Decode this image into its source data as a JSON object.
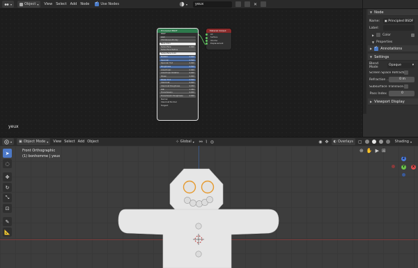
{
  "node_editor": {
    "header": {
      "mode": "Object",
      "menus": [
        "View",
        "Select",
        "Add",
        "Node"
      ],
      "use_nodes_label": "Use Nodes",
      "material_name": "yeux"
    },
    "object_name": "yeux",
    "bsdf_node": {
      "title": "Principled BSDF",
      "rows": [
        {
          "label": "BSDF",
          "value": "",
          "style": "plain"
        },
        {
          "label": "GGX",
          "value": "",
          "style": "grey"
        },
        {
          "label": "Christensen-Burley",
          "value": "",
          "style": "grey"
        },
        {
          "label": "Base Color",
          "value": "",
          "style": "white"
        },
        {
          "label": "Subsurface",
          "value": "0.000",
          "style": "grey"
        },
        {
          "label": "Subsurface Radius",
          "value": "",
          "style": "grey"
        },
        {
          "label": "Subsurface Color",
          "value": "",
          "style": "white"
        },
        {
          "label": "Metallic",
          "value": "0.000",
          "style": "blue"
        },
        {
          "label": "Specular",
          "value": "0.500",
          "style": "blue"
        },
        {
          "label": "Specular Tint",
          "value": "0.000",
          "style": "grey"
        },
        {
          "label": "Roughness",
          "value": "0.500",
          "style": "blue"
        },
        {
          "label": "Anisotropic",
          "value": "0.000",
          "style": "grey"
        },
        {
          "label": "Anisotropic Rotation",
          "value": "0.000",
          "style": "grey"
        },
        {
          "label": "Sheen",
          "value": "0.000",
          "style": "grey"
        },
        {
          "label": "Sheen Tint",
          "value": "0.500",
          "style": "blue"
        },
        {
          "label": "Clearcoat",
          "value": "0.000",
          "style": "grey"
        },
        {
          "label": "Clearcoat Roughness",
          "value": "0.030",
          "style": "grey"
        },
        {
          "label": "IOR",
          "value": "1.450",
          "style": "grey"
        },
        {
          "label": "Transmission",
          "value": "0.000",
          "style": "grey"
        },
        {
          "label": "Transmission Roughness",
          "value": "0.000",
          "style": "grey"
        },
        {
          "label": "Normal",
          "value": "",
          "style": "plain"
        },
        {
          "label": "Clearcoat Normal",
          "value": "",
          "style": "plain"
        },
        {
          "label": "Tangent",
          "value": "",
          "style": "plain"
        }
      ]
    },
    "output_node": {
      "title": "Material Output",
      "rows": [
        "All",
        "Surface",
        "Volume",
        "Displacement"
      ]
    }
  },
  "sidebar": {
    "node_panel": {
      "title": "Node",
      "name_label": "Name:",
      "name_value": "Principled BSDF",
      "label_label": "Label:",
      "label_value": "",
      "color_label": "Color",
      "properties_label": "Properties"
    },
    "annotations_label": "Annotations",
    "settings": {
      "title": "Settings",
      "blend_mode_label": "Blend Mode",
      "blend_mode_value": "Opaque",
      "ssr_label": "Screen Space Refracti...",
      "refraction_label": "Refraction ...",
      "refraction_value": "0 m",
      "sss_label": "Subsurface Translucе...",
      "pass_index_label": "Pass Index",
      "pass_index_value": "0"
    },
    "viewport_display_label": "Viewport Display"
  },
  "viewport": {
    "header": {
      "mode": "Object Mode",
      "menus": [
        "View",
        "Select",
        "Add",
        "Object"
      ],
      "orientation": "Global",
      "overlays_label": "Overlays",
      "shading_label": "Shading"
    },
    "view_name": "Front Orthographic",
    "collection_info": "(1) bonhomme | yeux",
    "gizmo": {
      "x": "X",
      "y": "Y",
      "z": "Z"
    }
  },
  "colors": {
    "accent_blue": "#4a7bc8",
    "bsdf_header": "#2d7a4c",
    "output_header": "#8a2a2a",
    "eye_outline": "#e69a2e",
    "axis_x": "#e24d4d",
    "axis_y": "#6ac44a",
    "axis_z": "#4a7be0"
  }
}
